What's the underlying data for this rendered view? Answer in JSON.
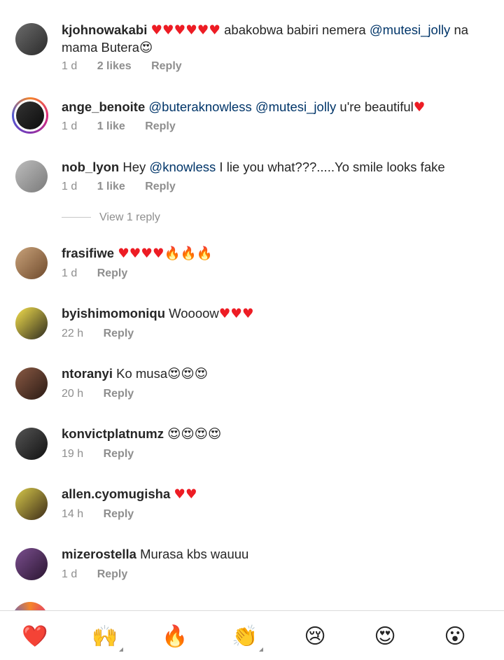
{
  "comments": [
    {
      "user": "kjohnowakabi",
      "hearts": "♥♥♥♥♥♥",
      "body_pre": " abakobwa babiri nemera ",
      "mention1": "@mutesi_jolly",
      "body_post": " na mama Butera",
      "emoji_tail": "😍",
      "time": "1 d",
      "likes": "2 likes",
      "reply": "Reply"
    },
    {
      "user": "ange_benoite",
      "mention1": "@buteraknowless",
      "mention2": "@mutesi_jolly",
      "body_post": " u're beautiful",
      "heart_tail": "♥",
      "time": "1 d",
      "likes": "1 like",
      "reply": "Reply"
    },
    {
      "user": "nob_lyon",
      "body_pre": " Hey ",
      "mention1": "@knowless",
      "body_post": " I lie you what???.....Yo smile looks fake",
      "time": "1 d",
      "likes": "1 like",
      "reply": "Reply",
      "view_replies": "View 1 reply"
    },
    {
      "user": "frasifiwe",
      "hearts": "♥♥♥♥",
      "fires": "🔥🔥🔥",
      "time": "1 d",
      "reply": "Reply"
    },
    {
      "user": "byishimomoniqu",
      "body_pre": " Woooow",
      "hearts": "♥♥♥",
      "time": "22 h",
      "reply": "Reply"
    },
    {
      "user": "ntoranyi",
      "body_pre": " Ko musa",
      "emojis": "😍😍😍",
      "time": "20 h",
      "reply": "Reply"
    },
    {
      "user": "konvictplatnumz",
      "emojis": "😍😍😍😍",
      "time": "19 h",
      "reply": "Reply"
    },
    {
      "user": "allen.cyomugisha",
      "hearts": "♥♥",
      "time": "14 h",
      "reply": "Reply"
    },
    {
      "user": "mizerostella",
      "body_pre": " Murasa kbs wauuu",
      "time": "1 d",
      "reply": "Reply"
    }
  ],
  "emoji_bar": [
    "❤️",
    "🙌",
    "🔥",
    "👏",
    "😢",
    "😍",
    "😮"
  ]
}
